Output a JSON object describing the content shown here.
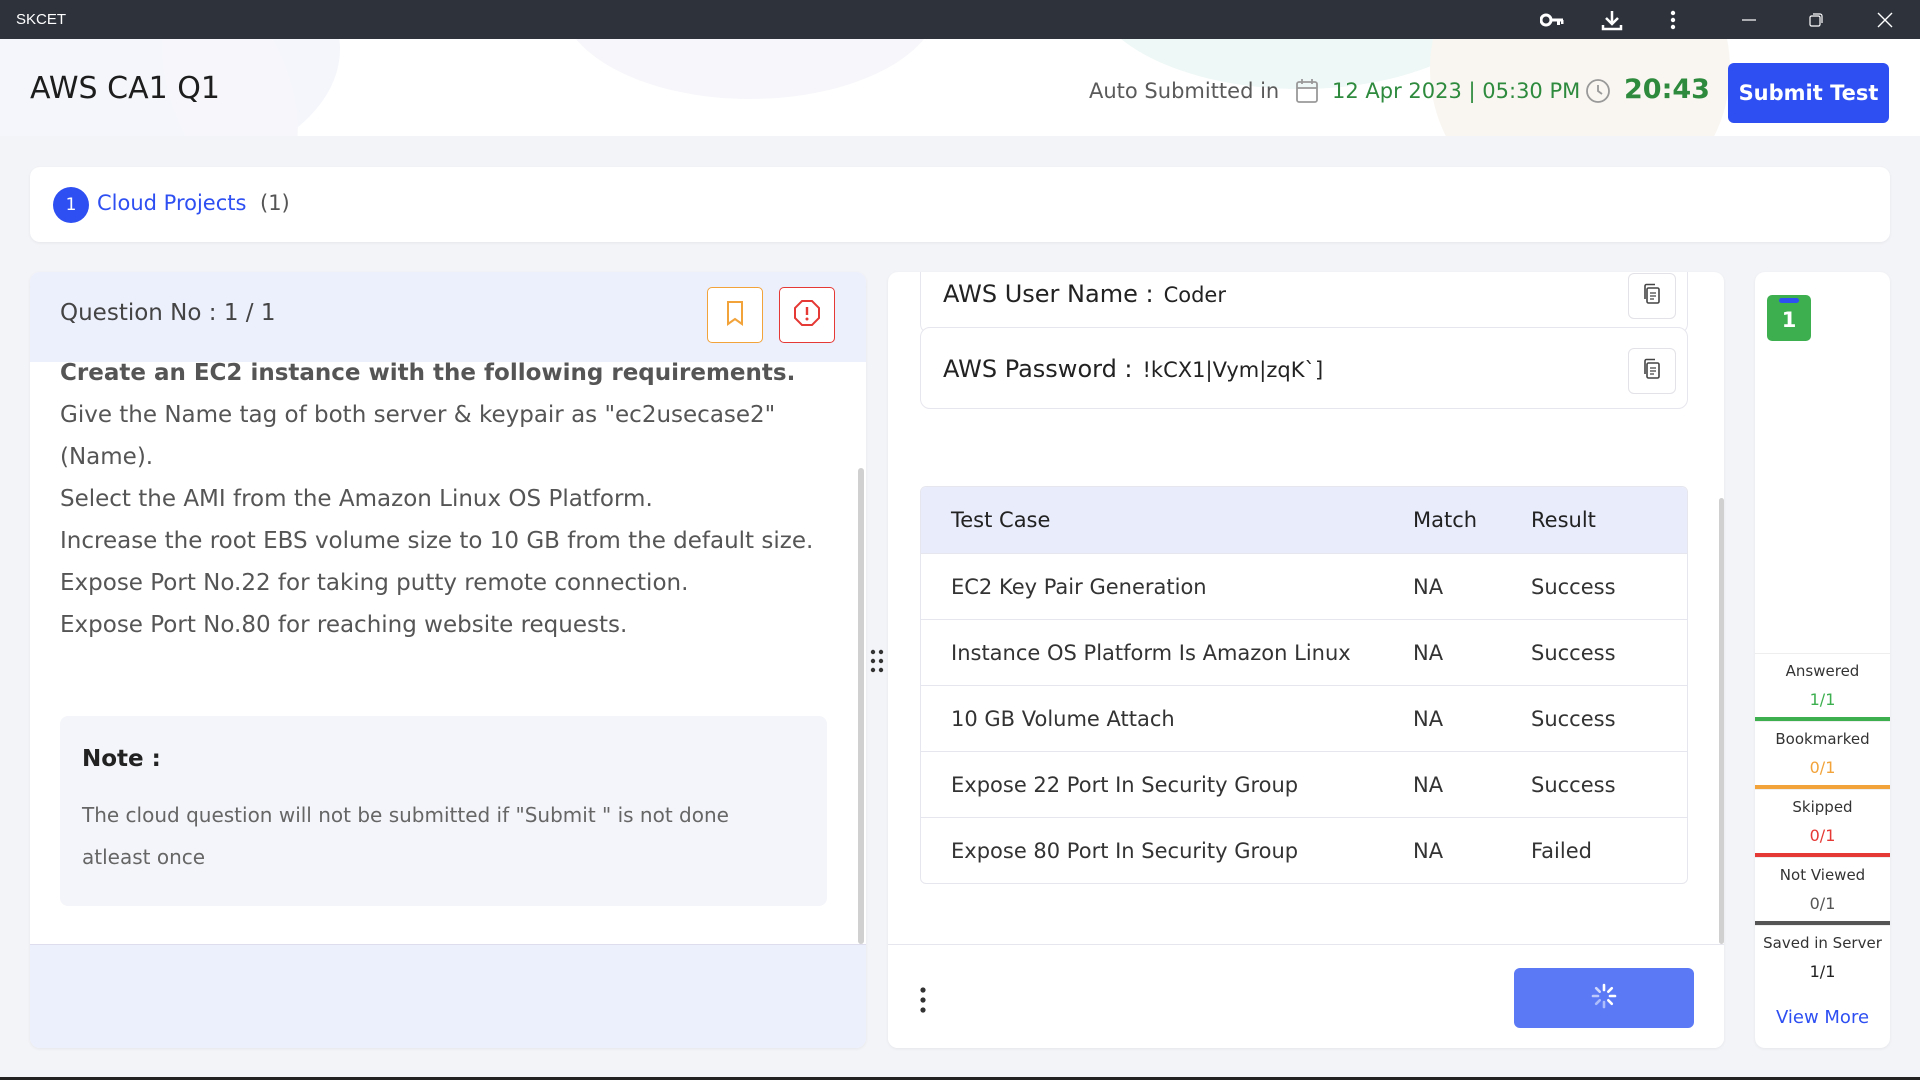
{
  "window": {
    "app_name": "SKCET"
  },
  "header": {
    "test_title": "AWS CA1 Q1",
    "auto_submitted_label": "Auto Submitted in",
    "deadline": "12 Apr 2023 | 05:30 PM",
    "timer": "20:43",
    "submit_label": "Submit Test"
  },
  "section": {
    "number": "1",
    "name": "Cloud Projects",
    "count": "(1)"
  },
  "question": {
    "number_label": "Question No : 1 / 1",
    "first_line": "Create an EC2 instance with the following requirements.",
    "lines": [
      "Give the Name tag of both server & keypair as \"ec2usecase2\" (Name).",
      "Select the AMI from the Amazon Linux OS Platform.",
      "Increase the root EBS volume size to 10 GB from the default size.",
      "Expose Port No.22 for taking putty remote connection.",
      "Expose Port No.80 for reaching website requests."
    ],
    "note_title": "Note :",
    "note_text": "The cloud question will not be submitted if \"Submit \" is not done atleast once"
  },
  "credentials": {
    "user_label": "AWS User Name :",
    "user_value": "Coder",
    "password_label": "AWS Password :",
    "password_value": "!kCX1|Vym|zqK`]"
  },
  "test_cases": {
    "headers": [
      "Test Case",
      "Match",
      "Result"
    ],
    "rows": [
      [
        "EC2 Key Pair Generation",
        "NA",
        "Success"
      ],
      [
        "Instance OS Platform Is Amazon Linux",
        "NA",
        "Success"
      ],
      [
        "10 GB Volume Attach",
        "NA",
        "Success"
      ],
      [
        "Expose 22 Port In Security Group",
        "NA",
        "Success"
      ],
      [
        "Expose 80 Port In Security Group",
        "NA",
        "Failed"
      ]
    ]
  },
  "status_panel": {
    "question_number": "1",
    "stats": [
      {
        "label": "Answered",
        "value": "1/1",
        "color": "#3daf4f"
      },
      {
        "label": "Bookmarked",
        "value": "0/1",
        "color": "#f2a33a"
      },
      {
        "label": "Skipped",
        "value": "0/1",
        "color": "#e53935"
      },
      {
        "label": "Not Viewed",
        "value": "0/1",
        "color": "#555555"
      },
      {
        "label": "Saved in Server",
        "value": "1/1",
        "color": "#222222"
      }
    ],
    "view_more": "View More"
  },
  "colors": {
    "accent": "#2e4ff2",
    "success": "#2e8b3e",
    "warning": "#f2a33a",
    "danger": "#e53935"
  },
  "icons": [
    "key-icon",
    "download-icon",
    "kebab-menu-icon",
    "minimize-icon",
    "restore-icon",
    "close-icon",
    "calendar-icon",
    "clock-icon",
    "bookmark-icon",
    "report-icon",
    "copy-icon",
    "drag-handle-icon",
    "more-vertical-icon",
    "spinner-icon"
  ]
}
